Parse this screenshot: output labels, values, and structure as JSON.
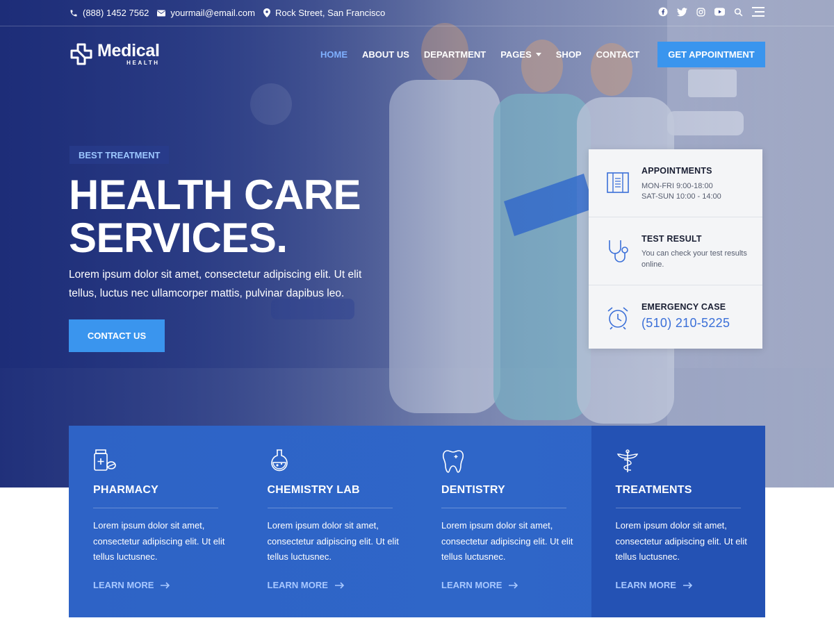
{
  "topbar": {
    "phone": "(888) 1452 7562",
    "email": "yourmail@email.com",
    "address": "Rock Street, San Francisco",
    "icons": [
      "facebook-icon",
      "twitter-icon",
      "instagram-icon",
      "youtube-icon",
      "search-icon",
      "menu-icon"
    ]
  },
  "logo": {
    "name": "Medical",
    "sub": "HEALTH"
  },
  "nav": {
    "items": [
      {
        "label": "HOME",
        "active": true
      },
      {
        "label": "ABOUT US"
      },
      {
        "label": "DEPARTMENT"
      },
      {
        "label": "PAGES",
        "dropdown": true
      },
      {
        "label": "SHOP"
      },
      {
        "label": "CONTACT"
      }
    ],
    "cta": "GET APPOINTMENT"
  },
  "hero": {
    "badge": "BEST TREATMENT",
    "headline_1": "HEALTH CARE",
    "headline_2": "SERVICES.",
    "lead": "Lorem ipsum dolor sit amet, consectetur adipiscing elit. Ut elit tellus, luctus nec ullamcorper mattis, pulvinar dapibus leo.",
    "button": "CONTACT US"
  },
  "info": {
    "appointments": {
      "title": "APPOINTMENTS",
      "line1": "MON-FRI 9:00-18:00",
      "line2": "SAT-SUN 10:00 - 14:00"
    },
    "test": {
      "title": "TEST RESULT",
      "text": "You can check your test results online."
    },
    "emergency": {
      "title": "EMERGENCY CASE",
      "phone": "(510) 210-5225"
    }
  },
  "services": [
    {
      "title": "PHARMACY",
      "desc": "Lorem ipsum dolor sit amet, consectetur adipiscing elit. Ut elit tellus luctusnec.",
      "more": "LEARN MORE"
    },
    {
      "title": "CHEMISTRY LAB",
      "desc": "Lorem ipsum dolor sit amet, consectetur adipiscing elit. Ut elit tellus luctusnec.",
      "more": "LEARN MORE"
    },
    {
      "title": "DENTISTRY",
      "desc": "Lorem ipsum dolor sit amet, consectetur adipiscing elit. Ut elit tellus luctusnec.",
      "more": "LEARN MORE"
    },
    {
      "title": "TREATMENTS",
      "desc": "Lorem ipsum dolor sit amet, consectetur adipiscing elit. Ut elit tellus luctusnec.",
      "more": "LEARN MORE"
    }
  ],
  "colors": {
    "accent": "#3a95ee",
    "nav_active": "#7fb0ff",
    "band": "#2e63c6",
    "band_dark": "#2452b4",
    "link": "#a8c8ff"
  }
}
